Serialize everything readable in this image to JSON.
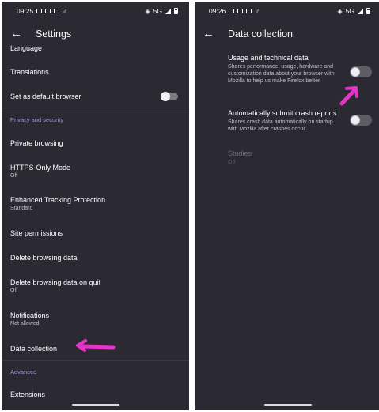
{
  "left": {
    "status": {
      "time": "09:25",
      "network": "5G"
    },
    "header": {
      "title": "Settings"
    },
    "items": [
      {
        "label": "Language",
        "sub": ""
      },
      {
        "label": "Translations",
        "sub": ""
      },
      {
        "label": "Set as default browser",
        "sub": ""
      },
      {
        "label": "Private browsing",
        "sub": ""
      },
      {
        "label": "HTTPS-Only Mode",
        "sub": "Off"
      },
      {
        "label": "Enhanced Tracking Protection",
        "sub": "Standard"
      },
      {
        "label": "Site permissions",
        "sub": ""
      },
      {
        "label": "Delete browsing data",
        "sub": ""
      },
      {
        "label": "Delete browsing data on quit",
        "sub": "Off"
      },
      {
        "label": "Notifications",
        "sub": "Not allowed"
      },
      {
        "label": "Data collection",
        "sub": ""
      },
      {
        "label": "Extensions",
        "sub": ""
      }
    ],
    "sections": {
      "privacy": "Privacy and security",
      "advanced": "Advanced"
    },
    "default_browser_toggle": false
  },
  "right": {
    "status": {
      "time": "09:26",
      "network": "5G"
    },
    "header": {
      "title": "Data collection"
    },
    "prefs": [
      {
        "label": "Usage and technical data",
        "desc": "Shares performance, usage, hardware and customization data about your browser with Mozilla to help us make Firefox better",
        "enabled": false
      },
      {
        "label": "Automatically submit crash reports",
        "desc": "Shares crash data automatically on startup with Mozilla after crashes occur",
        "enabled": false
      },
      {
        "label": "Studies",
        "desc": "Off",
        "enabled": false,
        "disabled": true
      }
    ]
  },
  "colors": {
    "background": "#2b2a33",
    "accent": "#a28ee6",
    "annotation": "#e534c7"
  }
}
